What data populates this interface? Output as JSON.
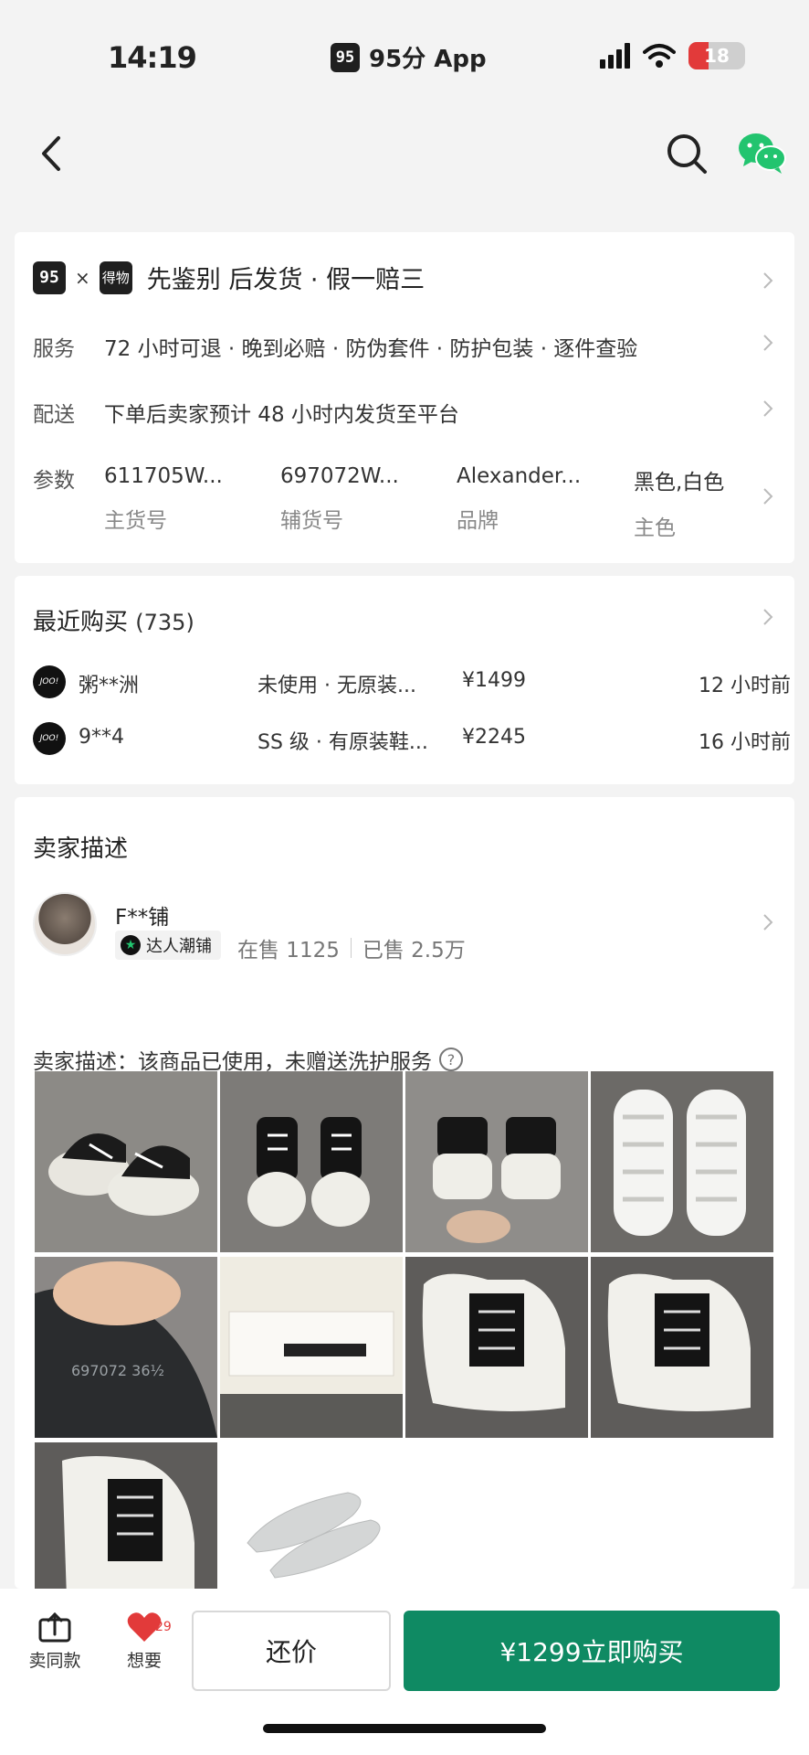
{
  "status": {
    "time": "14:19",
    "app_name": "95分 App",
    "battery": "18"
  },
  "guarantee": {
    "title": "先鉴别 后发货 · 假一赔三",
    "logo1": "95",
    "logo2": "得物",
    "service_label": "服务",
    "service_value": "72 小时可退 · 晚到必赔 · 防伪套件 · 防护包装 · 逐件查验",
    "delivery_label": "配送",
    "delivery_value": "下单后卖家预计 48 小时内发货至平台",
    "params_label": "参数",
    "params": [
      {
        "value": "611705W...",
        "key": "主货号"
      },
      {
        "value": "697072W...",
        "key": "辅货号"
      },
      {
        "value": "Alexander...",
        "key": "品牌"
      },
      {
        "value": "黑色,白色",
        "key": "主色"
      }
    ]
  },
  "recent": {
    "title": "最近购买",
    "count": "(735)",
    "rows": [
      {
        "avatar": "JOO!",
        "name": "粥**洲",
        "condition": "未使用 · 无原装...",
        "price": "¥1499",
        "time": "12 小时前"
      },
      {
        "avatar": "JOO!",
        "name": "9**4",
        "condition": "SS 级 · 有原装鞋...",
        "price": "¥2245",
        "time": "16 小时前"
      }
    ]
  },
  "seller": {
    "section_title": "卖家描述",
    "name": "F**铺",
    "badge": "达人潮铺",
    "on_sale": "在售 1125",
    "sold": "已售 2.5万",
    "description": "卖家描述：该商品已使用，未赠送洗护服务",
    "photo_label_text": "697072 36½"
  },
  "bottom": {
    "sell_same": "卖同款",
    "want": "想要",
    "want_count": "29",
    "counter_offer": "还价",
    "buy_now": "¥1299立即购买"
  },
  "colors": {
    "accent": "#0f8a63",
    "wechat": "#22c46f",
    "heart": "#e23a3a"
  }
}
